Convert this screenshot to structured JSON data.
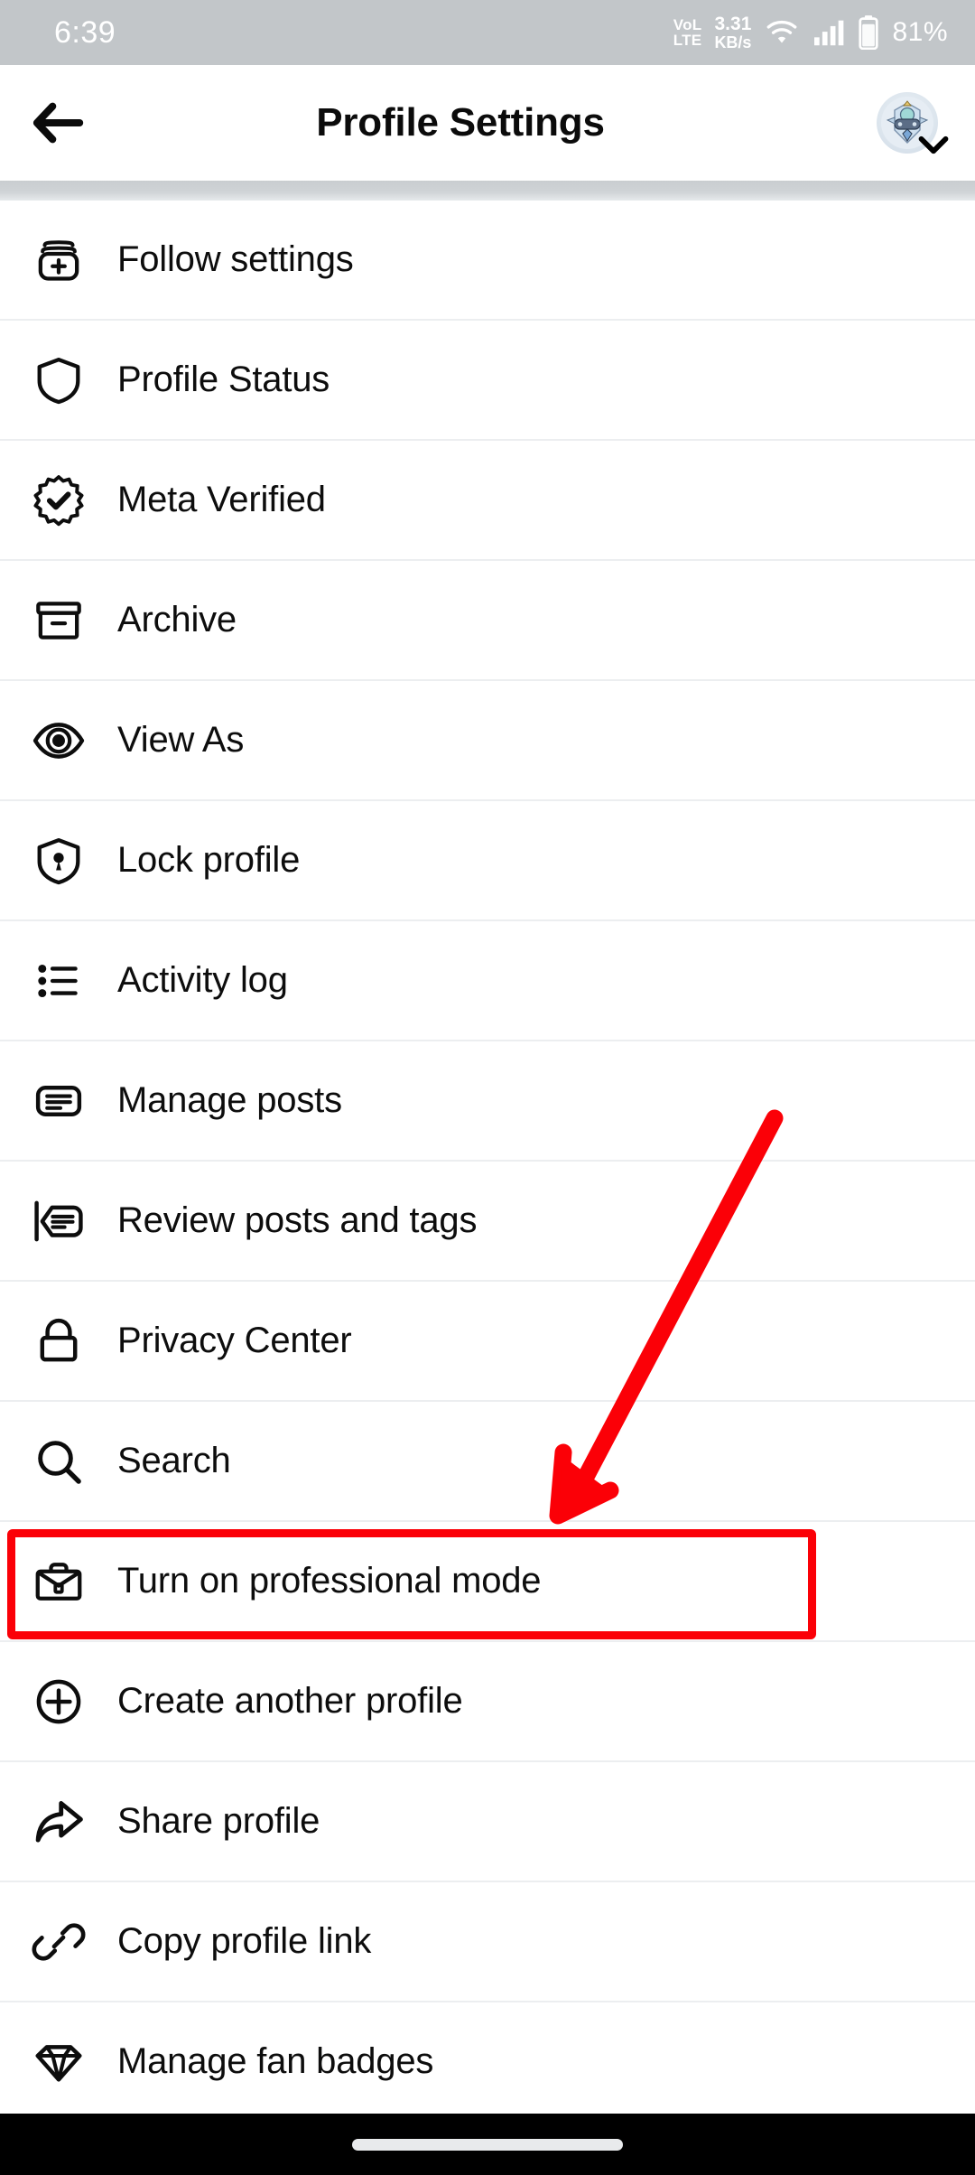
{
  "status_bar": {
    "time": "6:39",
    "volte_top": "VoLTE",
    "volte_line1": "VoL",
    "volte_line2": "LTE",
    "net_speed_value": "3.31",
    "net_speed_unit": "KB/s",
    "wifi_icon": "wifi-icon",
    "signal_icon": "cellular-signal-icon",
    "battery_icon": "battery-icon",
    "battery_percent": "81%"
  },
  "app_bar": {
    "back_icon": "back-arrow-icon",
    "title": "Profile Settings",
    "avatar_icon": "profile-avatar",
    "chevron_icon": "chevron-down-icon"
  },
  "list": {
    "items": [
      {
        "label": "Follow settings",
        "icon": "follow-settings-icon"
      },
      {
        "label": "Profile Status",
        "icon": "shield-icon"
      },
      {
        "label": "Meta Verified",
        "icon": "verified-badge-icon"
      },
      {
        "label": "Archive",
        "icon": "archive-box-icon"
      },
      {
        "label": "View As",
        "icon": "eye-icon"
      },
      {
        "label": "Lock profile",
        "icon": "shield-lock-icon"
      },
      {
        "label": "Activity log",
        "icon": "bulleted-list-icon"
      },
      {
        "label": "Manage posts",
        "icon": "manage-posts-icon"
      },
      {
        "label": "Review posts and tags",
        "icon": "review-posts-icon"
      },
      {
        "label": "Privacy Center",
        "icon": "padlock-icon"
      },
      {
        "label": "Search",
        "icon": "search-icon"
      },
      {
        "label": "Turn on professional mode",
        "icon": "briefcase-icon"
      },
      {
        "label": "Create another profile",
        "icon": "plus-circle-icon"
      },
      {
        "label": "Share profile",
        "icon": "share-arrow-icon"
      },
      {
        "label": "Copy profile link",
        "icon": "link-chain-icon"
      },
      {
        "label": "Manage fan badges",
        "icon": "diamond-icon"
      }
    ]
  },
  "annotations": {
    "highlight_color": "#fb0007",
    "highlighted_item_label": "Turn on professional mode",
    "arrow_color": "#fb0007",
    "arrow_icon": "pointer-arrow-annotation"
  },
  "nav_bar": {
    "home_indicator": "home-indicator"
  }
}
